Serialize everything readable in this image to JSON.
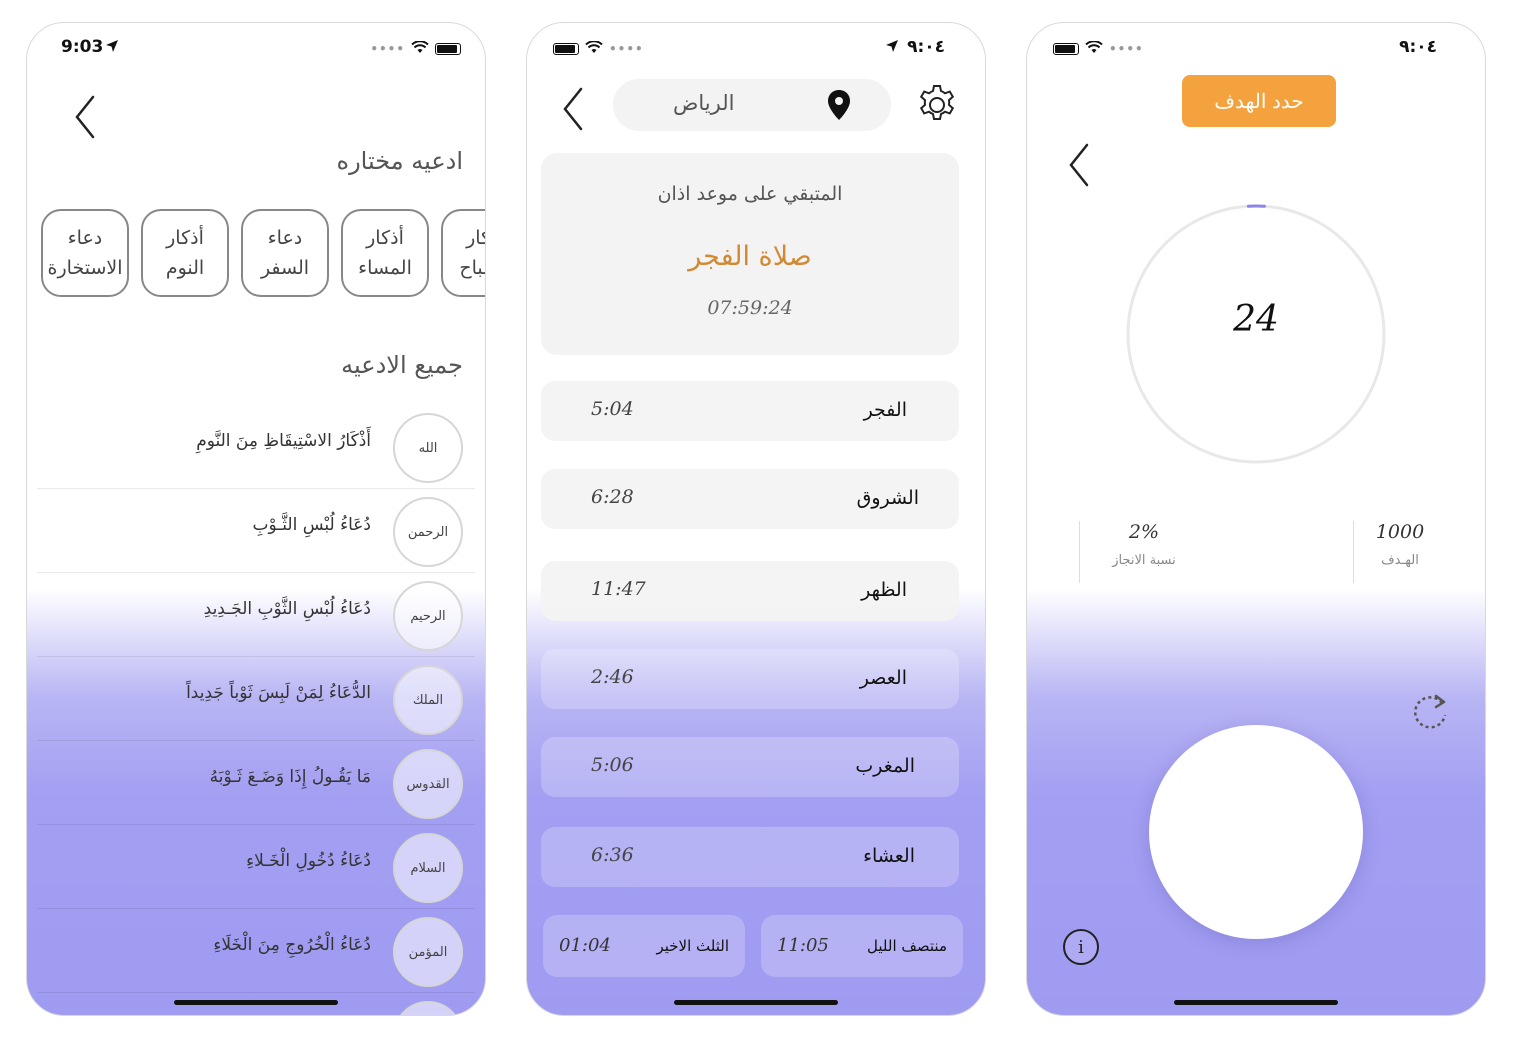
{
  "phone1": {
    "status_time": "9:03",
    "section_selected": "ادعيه مختاره",
    "chips": [
      {
        "label": "أذكار\nالصباح"
      },
      {
        "label": "أذكار\nالمساء"
      },
      {
        "label": "دعاء\nالسفر"
      },
      {
        "label": "أذكار\nالنوم"
      },
      {
        "label": "دعاء\nالاستخارة"
      }
    ],
    "section_all": "جميع الادعيه",
    "duas": [
      {
        "name": "الله",
        "text": "أَذْكَارُ الاسْتِيقَاظِ مِنَ النَّومِ"
      },
      {
        "name": "الرحمن",
        "text": "دُعَاءُ لُبْسِ الثَّـوْبِ"
      },
      {
        "name": "الرحيم",
        "text": "دُعَاءُ لُبْسِ الثَّوْبِ الجَـدِيدِ"
      },
      {
        "name": "الملك",
        "text": "الدُّعَاءُ لِمَنْ لَبِسَ ثَوْباً جَدِيداً"
      },
      {
        "name": "القدوس",
        "text": "مَا يَقُـولُ إِذَا وَضَـعَ ثَـوْبَهُ"
      },
      {
        "name": "السلام",
        "text": "دُعَاءُ دُخُولِ الْخَـلاءِ"
      },
      {
        "name": "المؤمن",
        "text": "دُعَاءُ الْخُرُوجِ مِنَ الْخَلَاءِ"
      }
    ]
  },
  "phone2": {
    "status_time": "٩:٠٤",
    "city": "الرياض",
    "next_label": "المتبقي على موعد اذان",
    "next_prayer": "صلاة الفجر",
    "countdown": "07:59:24",
    "prayers": [
      {
        "name": "الفجر",
        "time": "5:04"
      },
      {
        "name": "الشروق",
        "time": "6:28"
      },
      {
        "name": "الظهر",
        "time": "11:47"
      },
      {
        "name": "العصر",
        "time": "2:46"
      },
      {
        "name": "المغرب",
        "time": "5:06"
      },
      {
        "name": "العشاء",
        "time": "6:36"
      }
    ],
    "last_third": {
      "name": "الثلث الاخير",
      "time": "01:04"
    },
    "midnight": {
      "name": "منتصف الليل",
      "time": "11:05"
    }
  },
  "phone3": {
    "status_time": "٩:٠٤",
    "goal_button": "حدد الهدف",
    "count": "24",
    "progress_fraction": 0.02,
    "achievement_value": "2%",
    "achievement_label": "نسبة الانجاز",
    "goal_value": "1000",
    "goal_label": "الهـدف",
    "info": "i"
  },
  "colors": {
    "accent_purple": "#9f9bf1",
    "accent_orange": "#f4a23e",
    "prayer_gold": "#d28a32"
  },
  "icons": [
    "back-chevron-icon",
    "location-pin-icon",
    "gear-icon",
    "reset-icon",
    "info-icon",
    "wifi-icon",
    "battery-icon",
    "location-arrow-icon"
  ]
}
